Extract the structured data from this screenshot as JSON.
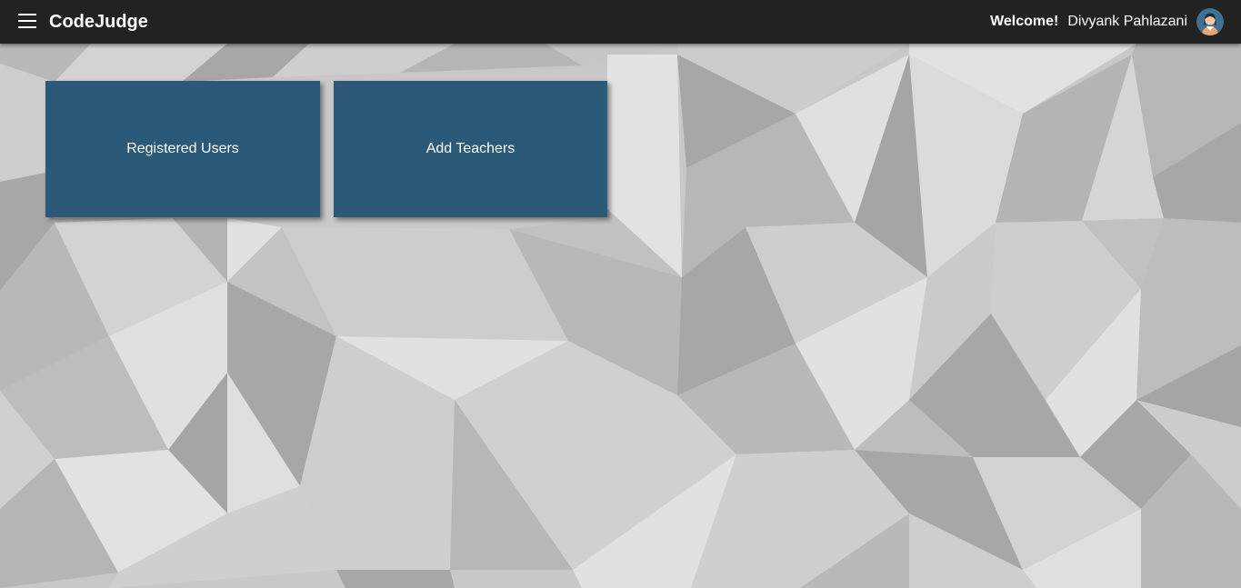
{
  "app": {
    "title": "CodeJudge",
    "menu_icon": "hamburger-menu-icon"
  },
  "user": {
    "welcome_label": "Welcome!",
    "name": "Divyank Pahlazani",
    "avatar_icon": "user-avatar-icon"
  },
  "cards": [
    {
      "label": "Registered Users"
    },
    {
      "label": "Add Teachers"
    }
  ],
  "colors": {
    "topbar": "#222222",
    "card": "#2a5a78",
    "text": "#ffffff"
  }
}
